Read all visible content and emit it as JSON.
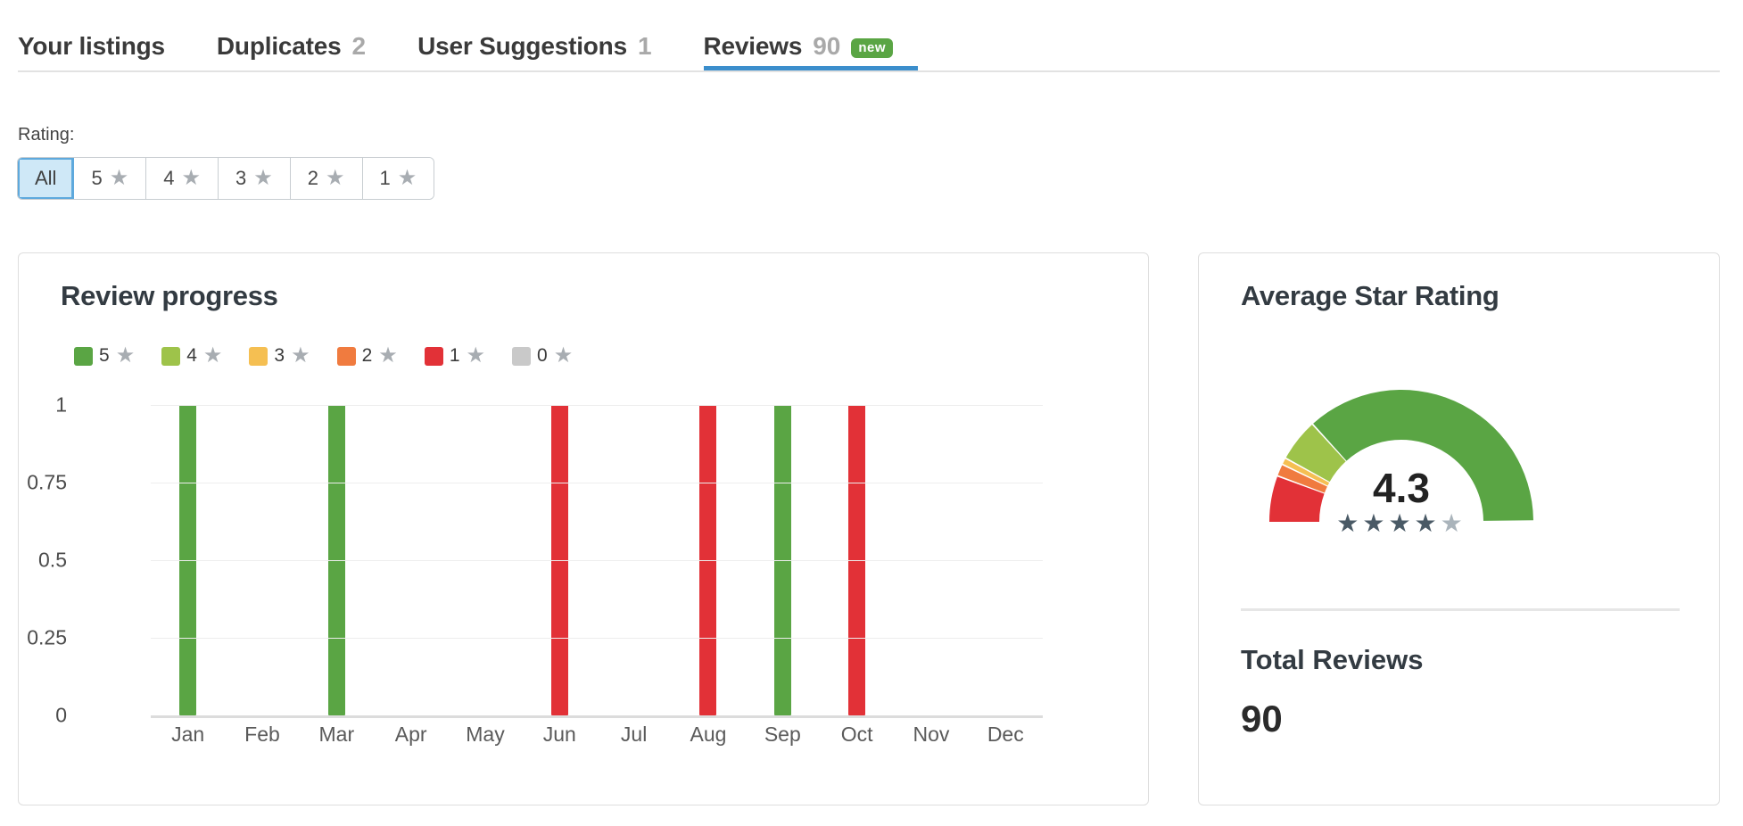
{
  "tabs": [
    {
      "label": "Your listings",
      "count": "",
      "active": false,
      "badge": ""
    },
    {
      "label": "Duplicates",
      "count": "2",
      "active": false,
      "badge": ""
    },
    {
      "label": "User Suggestions",
      "count": "1",
      "active": false,
      "badge": ""
    },
    {
      "label": "Reviews",
      "count": "90",
      "active": true,
      "badge": "new"
    }
  ],
  "filter": {
    "label": "Rating:",
    "options": [
      {
        "label": "All",
        "star": false,
        "selected": true
      },
      {
        "label": "5",
        "star": true,
        "selected": false
      },
      {
        "label": "4",
        "star": true,
        "selected": false
      },
      {
        "label": "3",
        "star": true,
        "selected": false
      },
      {
        "label": "2",
        "star": true,
        "selected": false
      },
      {
        "label": "1",
        "star": true,
        "selected": false
      }
    ]
  },
  "left_card": {
    "title": "Review progress"
  },
  "right_card": {
    "title": "Average Star Rating",
    "gauge_value": "4.3",
    "stars_filled": 4,
    "stars_total": 5,
    "total_title": "Total Reviews",
    "total_value": "90"
  },
  "colors": {
    "star5": "#5aa544",
    "star4": "#9ec34a",
    "star3": "#f5bf52",
    "star2": "#f07b3f",
    "star1": "#e23137",
    "star0": "#c9c9c9",
    "accent": "#3b8ecc",
    "badge_green": "#5aa544"
  },
  "chart_data": {
    "type": "bar",
    "title": "Review progress",
    "xlabel": "",
    "ylabel": "",
    "ylim": [
      0,
      1
    ],
    "yticks": [
      "1",
      "0.75",
      "0.5",
      "0.25",
      "0"
    ],
    "ytick_values": [
      1,
      0.75,
      0.5,
      0.25,
      0
    ],
    "grid": true,
    "legend_position": "top-left",
    "legend": [
      {
        "label": "5",
        "star": true,
        "color": "#5aa544"
      },
      {
        "label": "4",
        "star": true,
        "color": "#9ec34a"
      },
      {
        "label": "3",
        "star": true,
        "color": "#f5bf52"
      },
      {
        "label": "2",
        "star": true,
        "color": "#f07b3f"
      },
      {
        "label": "1",
        "star": true,
        "color": "#e23137"
      },
      {
        "label": "0",
        "star": true,
        "color": "#c9c9c9"
      }
    ],
    "categories": [
      "Jan",
      "Feb",
      "Mar",
      "Apr",
      "May",
      "Jun",
      "Jul",
      "Aug",
      "Sep",
      "Oct",
      "Nov",
      "Dec"
    ],
    "values": [
      1,
      0,
      1,
      0,
      0,
      1,
      0,
      1,
      1,
      1,
      0,
      0
    ],
    "bar_colors": [
      "#5aa544",
      "",
      "#5aa544",
      "",
      "",
      "#e23137",
      "",
      "#e23137",
      "#5aa544",
      "#e23137",
      "",
      ""
    ]
  },
  "gauge_data": {
    "type": "pie",
    "title": "Average Star Rating",
    "value": 4.3,
    "max": 5,
    "segments": [
      {
        "name": "1 star",
        "color": "#e23137",
        "fraction": 0.115
      },
      {
        "name": "2 stars",
        "color": "#f07b3f",
        "fraction": 0.03
      },
      {
        "name": "3 stars",
        "color": "#f5bf52",
        "fraction": 0.017
      },
      {
        "name": "4 stars",
        "color": "#9ec34a",
        "fraction": 0.105
      },
      {
        "name": "5 stars",
        "color": "#5aa544",
        "fraction": 0.733
      }
    ]
  }
}
